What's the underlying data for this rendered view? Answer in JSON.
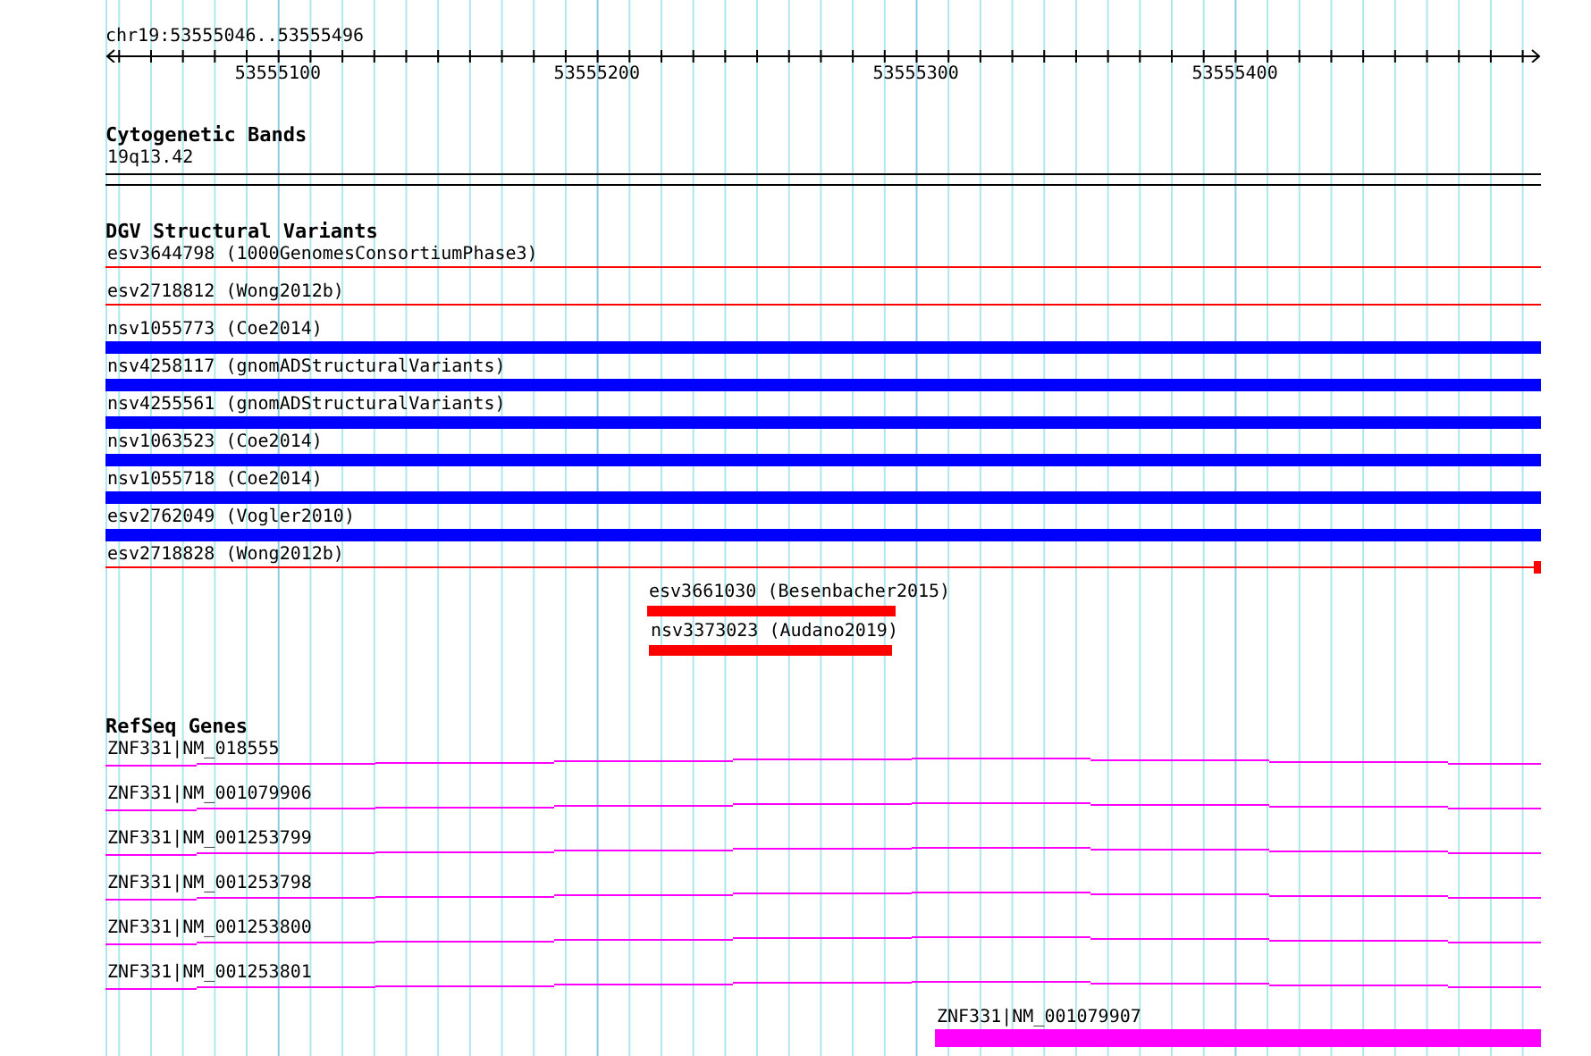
{
  "ruler": {
    "location": "chr19:53555046..53555496",
    "ticks": [
      "53555100",
      "53555200",
      "53555300",
      "53555400"
    ]
  },
  "tracks": [
    {
      "kind": "bands",
      "title": "Cytogenetic Bands",
      "items": [
        {
          "label": "19q13.42"
        }
      ]
    },
    {
      "kind": "variants",
      "title": "DGV Structural Variants",
      "items": [
        {
          "label": "esv3644798 (1000GenomesConsortiumPhase3)",
          "kind": "line",
          "color": "#ff0000"
        },
        {
          "label": "esv2718812 (Wong2012b)",
          "kind": "line",
          "color": "#ff0000"
        },
        {
          "label": "nsv1055773 (Coe2014)",
          "kind": "bar",
          "color": "#0000ff"
        },
        {
          "label": "nsv4258117 (gnomADStructuralVariants)",
          "kind": "bar",
          "color": "#0000ff"
        },
        {
          "label": "nsv4255561 (gnomADStructuralVariants)",
          "kind": "bar",
          "color": "#0000ff"
        },
        {
          "label": "nsv1063523 (Coe2014)",
          "kind": "bar",
          "color": "#0000ff"
        },
        {
          "label": "nsv1055718 (Coe2014)",
          "kind": "bar",
          "color": "#0000ff"
        },
        {
          "label": "esv2762049 (Vogler2010)",
          "kind": "bar",
          "color": "#0000ff"
        },
        {
          "label": "esv2718828 (Wong2012b)",
          "kind": "line-end",
          "color": "#ff0000"
        },
        {
          "label": "esv3661030 (Besenbacher2015)",
          "kind": "short-bar",
          "color": "#ff0000"
        },
        {
          "label": "nsv3373023 (Audano2019)",
          "kind": "short-bar",
          "color": "#ff0000"
        }
      ]
    },
    {
      "kind": "genes",
      "title": "RefSeq Genes",
      "items": [
        {
          "label": "ZNF331|NM_018555",
          "kind": "transcript"
        },
        {
          "label": "ZNF331|NM_001079906",
          "kind": "transcript"
        },
        {
          "label": "ZNF331|NM_001253799",
          "kind": "transcript"
        },
        {
          "label": "ZNF331|NM_001253798",
          "kind": "transcript"
        },
        {
          "label": "ZNF331|NM_001253800",
          "kind": "transcript"
        },
        {
          "label": "ZNF331|NM_001253801",
          "kind": "transcript"
        },
        {
          "label": "ZNF331|NM_001079907",
          "kind": "block"
        }
      ]
    }
  ]
}
